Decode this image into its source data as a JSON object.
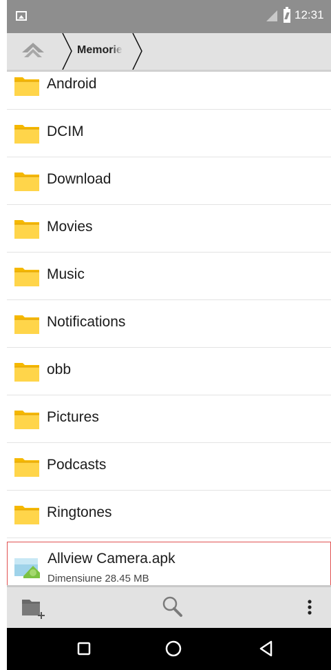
{
  "status_bar": {
    "time": "12:31",
    "icons": [
      "picture-icon",
      "no-sim-icon",
      "battery-charging-icon"
    ]
  },
  "breadcrumb": {
    "home_icon": "home-icon",
    "current": "Memorie"
  },
  "files": [
    {
      "name": "Android",
      "type": "folder"
    },
    {
      "name": "DCIM",
      "type": "folder"
    },
    {
      "name": "Download",
      "type": "folder"
    },
    {
      "name": "Movies",
      "type": "folder"
    },
    {
      "name": "Music",
      "type": "folder"
    },
    {
      "name": "Notifications",
      "type": "folder"
    },
    {
      "name": "obb",
      "type": "folder"
    },
    {
      "name": "Pictures",
      "type": "folder"
    },
    {
      "name": "Podcasts",
      "type": "folder"
    },
    {
      "name": "Ringtones",
      "type": "folder"
    }
  ],
  "apk_file": {
    "name": "Allview Camera.apk",
    "size_text": "Dimensiune 28.45 MB",
    "highlight_color": "#e05050"
  },
  "toolbar": {
    "icons": [
      "new-folder-icon",
      "search-icon",
      "more-options-icon"
    ]
  },
  "nav_bar": {
    "icons": [
      "recents-icon",
      "home-circle-icon",
      "back-icon"
    ]
  },
  "colors": {
    "folder": "#f5b800",
    "folder_light": "#ffd54a",
    "status_bar": "#8e8e8e",
    "bars": "#e2e2e2"
  }
}
